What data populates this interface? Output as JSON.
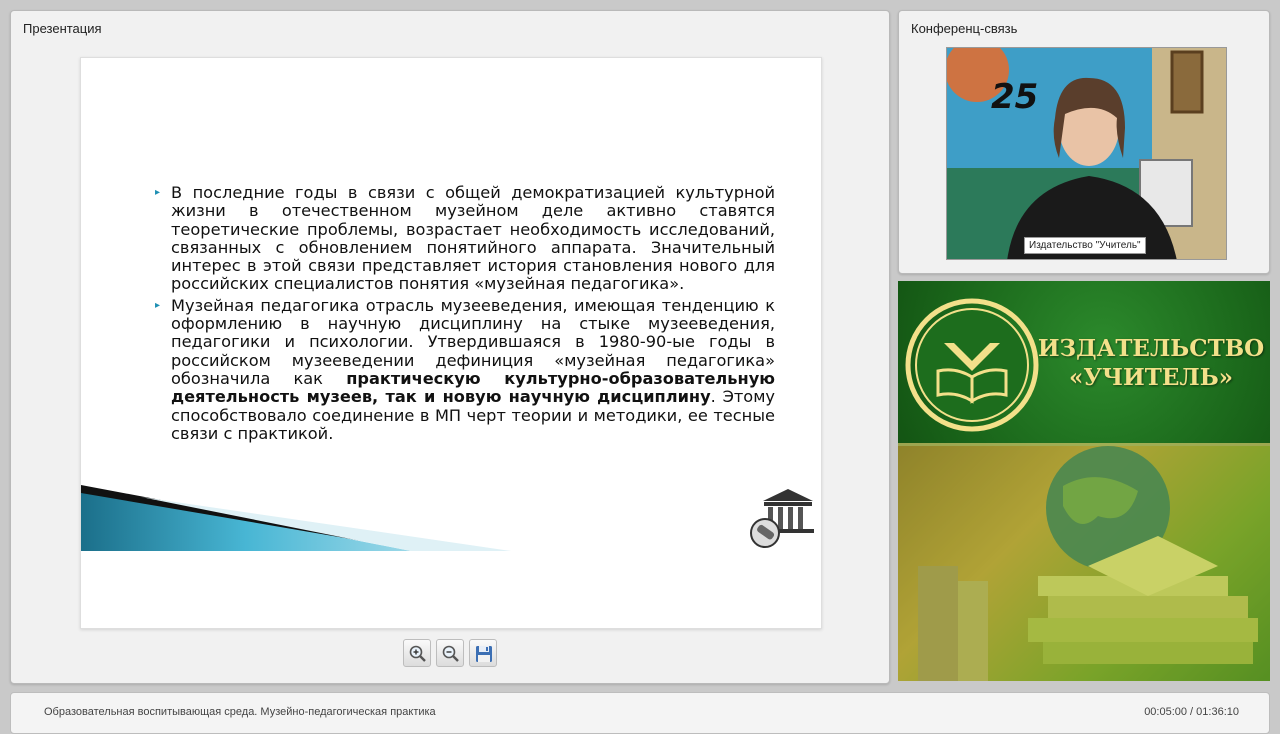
{
  "presentation_panel": {
    "title": "Презентация",
    "slide": {
      "paragraphs": [
        [
          {
            "text": "В последние годы в связи с общей демократизацией культурной жизни в отечественном музейном деле активно ставятся теоретические проблемы, возрастает необходимость исследований, связанных с обновлением понятийного аппарата. Значительный интерес в этой связи представляет история становления нового для российских специалистов понятия «музейная педагогика».",
            "bold": false
          }
        ],
        [
          {
            "text": "Музейная педагогика отрасль музееведения, имеющая тенденцию к оформлению в научную дисциплину на стыке музееведения, педагогики и психологии. Утвердившаяся в 1980-90-ые годы в российском музееведении дефиниция «музейная педагогика» обозначила как ",
            "bold": false
          },
          {
            "text": "практическую культурно-образовательную деятельность музеев, так и новую научную дисциплину",
            "bold": true
          },
          {
            "text": ". Этому способствовало соединение в МП черт теории и методики, ее тесные связи с практикой.",
            "bold": false
          }
        ]
      ]
    },
    "toolbar": [
      {
        "name": "zoom-in-button",
        "icon": "zoom-in-icon"
      },
      {
        "name": "zoom-out-button",
        "icon": "zoom-out-icon"
      },
      {
        "name": "save-button",
        "icon": "save-icon"
      }
    ]
  },
  "conference_panel": {
    "title": "Конференц-связь",
    "video_label": "Издательство \"Учитель\"",
    "poster_number": "25"
  },
  "banner": {
    "line1": "ИЗДАТЕЛЬСТВО",
    "line2": "«УЧИТЕЛЬ»"
  },
  "footer": {
    "title": "Образовательная воспитывающая среда. Музейно-педагогическая практика",
    "time": "00:05:00 / 01:36:10"
  },
  "colors": {
    "bullet": "#1e8fb3",
    "banner_green": "#1c6a1c",
    "banner_text": "#f3e08a"
  }
}
